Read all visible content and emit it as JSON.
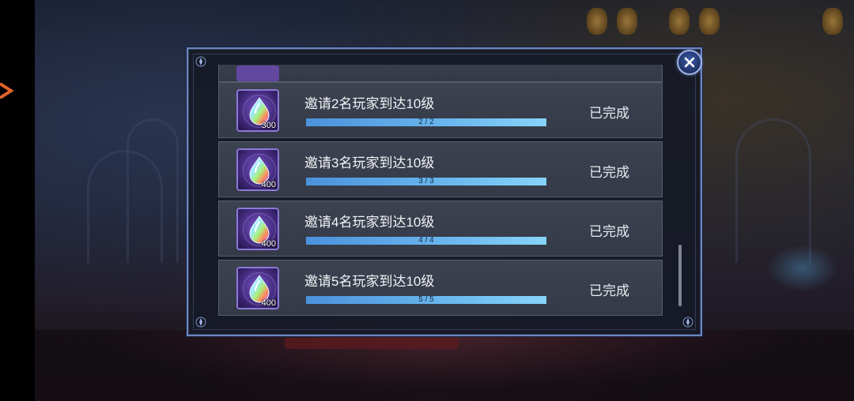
{
  "tasks": [
    {
      "title": "邀请2名玩家到达10级",
      "progress_text": "2 / 2",
      "progress": 1.0,
      "reward_qty": "300",
      "status": "已完成"
    },
    {
      "title": "邀请3名玩家到达10级",
      "progress_text": "3 / 3",
      "progress": 1.0,
      "reward_qty": "400",
      "status": "已完成"
    },
    {
      "title": "邀请4名玩家到达10级",
      "progress_text": "4 / 4",
      "progress": 1.0,
      "reward_qty": "400",
      "status": "已完成"
    },
    {
      "title": "邀请5名玩家到达10级",
      "progress_text": "5 / 5",
      "progress": 1.0,
      "reward_qty": "400",
      "status": "已完成"
    }
  ],
  "icons": {
    "reward": "rainbow-crystal-icon",
    "close": "close-icon"
  },
  "colors": {
    "panel_border": "#6a86c4",
    "progress_fill": "#6ab8ee",
    "reward_frame": "#8b7ad8"
  }
}
